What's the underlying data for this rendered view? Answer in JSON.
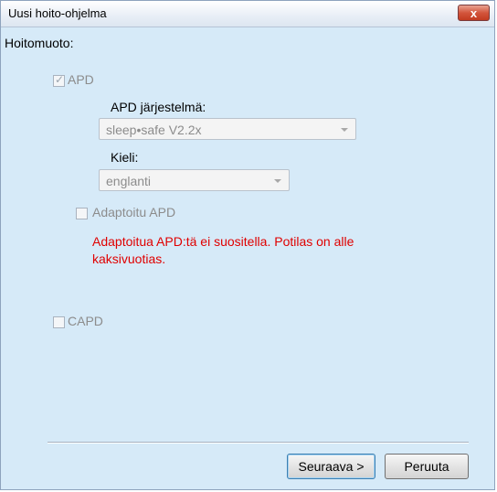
{
  "window": {
    "title": "Uusi hoito-ohjelma",
    "close_symbol": "x"
  },
  "form": {
    "treatment_label": "Hoitomuoto:",
    "apd": {
      "label": "APD",
      "checked": true,
      "enabled": false
    },
    "apd_system": {
      "label": "APD järjestelmä:",
      "selected": "sleep•safe V2.2x"
    },
    "language": {
      "label": "Kieli:",
      "selected": "englanti"
    },
    "adapted_apd": {
      "label": "Adaptoitu APD",
      "checked": false,
      "enabled": false
    },
    "warning": "Adaptoitua APD:tä ei suositella. Potilas on alle kaksivuotias.",
    "capd": {
      "label": "CAPD",
      "checked": false,
      "enabled": false
    }
  },
  "buttons": {
    "next": "Seuraava >",
    "cancel": "Peruuta"
  },
  "colors": {
    "background": "#d6eaf8",
    "warning": "#e00000",
    "disabled_text": "#8c8c8c"
  }
}
